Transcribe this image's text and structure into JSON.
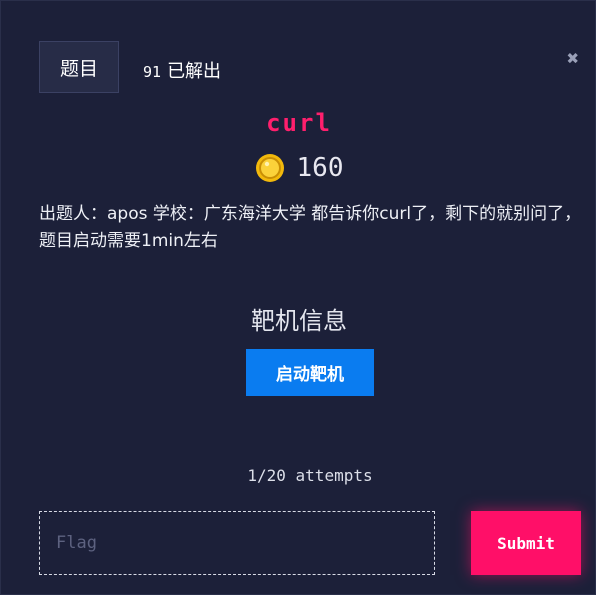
{
  "modal": {
    "tab_label": "题目",
    "solves_count": "91",
    "solves_label": "已解出",
    "close_symbol": "✖"
  },
  "challenge": {
    "name": "curl",
    "points": "160",
    "description": "出题人：apos 学校：广东海洋大学 都告诉你curl了，剩下的就别问了，题目启动需要1min左右"
  },
  "target": {
    "section_title": "靶机信息",
    "start_button": "启动靶机"
  },
  "submission": {
    "attempts": "1/20 attempts",
    "flag_placeholder": "Flag",
    "submit_label": "Submit"
  },
  "colors": {
    "background": "#1c2039",
    "accent_pink": "#ff0f68",
    "start_blue": "#0a7cf0",
    "coin_gold": "#f2b90c"
  },
  "icons": {
    "coin": "coin-icon",
    "close": "close-icon"
  }
}
